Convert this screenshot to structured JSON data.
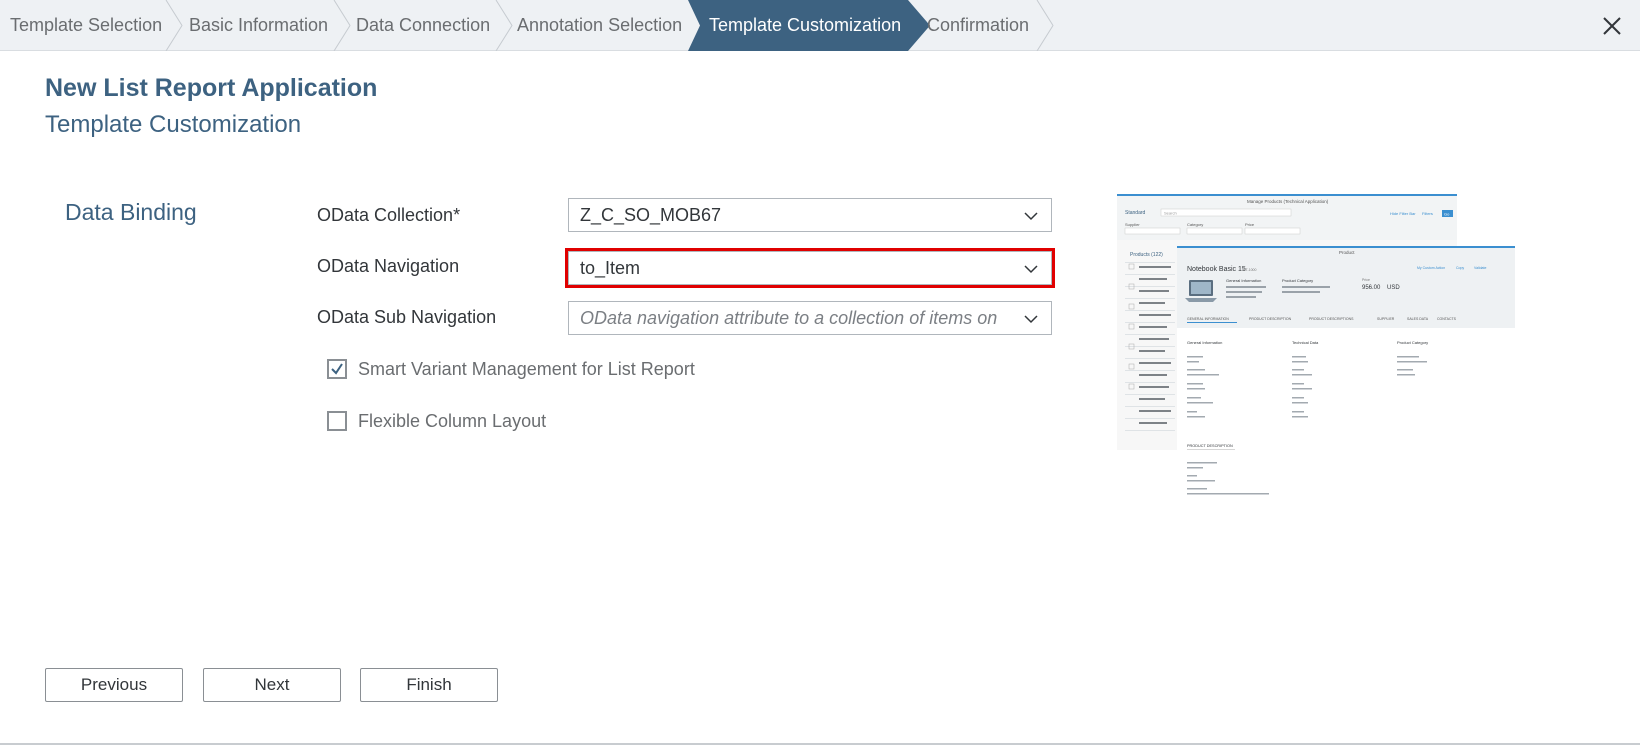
{
  "wizard": {
    "steps": [
      {
        "label": "Template Selection",
        "active": false
      },
      {
        "label": "Basic Information",
        "active": false
      },
      {
        "label": "Data Connection",
        "active": false
      },
      {
        "label": "Annotation Selection",
        "active": false
      },
      {
        "label": "Template Customization",
        "active": true
      },
      {
        "label": "Confirmation",
        "active": false
      }
    ],
    "active_color": "#3d6281"
  },
  "header": {
    "app_title": "New List Report Application",
    "page_subtitle": "Template Customization"
  },
  "data_binding": {
    "section_title": "Data Binding",
    "odata_collection": {
      "label": "OData Collection*",
      "value": "Z_C_SO_MOB67"
    },
    "odata_navigation": {
      "label": "OData Navigation",
      "value": "to_Item"
    },
    "odata_sub_navigation": {
      "label": "OData Sub Navigation",
      "placeholder": "OData navigation attribute to a collection of items on su"
    },
    "smart_variant": {
      "label": "Smart Variant Management for List Report",
      "checked": true
    },
    "flexible_column": {
      "label": "Flexible Column Layout",
      "checked": false
    }
  },
  "preview": {
    "list_header": "Manage Products (Technical Application)",
    "standard": "Standard",
    "search_placeholder": "Search",
    "filter_supplier": "Supplier",
    "filter_category": "Category",
    "filter_price": "Price",
    "hide_filter_bar": "Hide Filter Bar",
    "filters": "Filters",
    "go": "Go",
    "products_count": "Products (122)",
    "object_header": "Product",
    "product_title": "Notebook Basic 15",
    "product_id": "HT-1000",
    "actions": [
      "My Custom Action",
      "Copy",
      "Validate"
    ],
    "general_info": "General Information",
    "product_category": "Product Category",
    "price_label": "Price",
    "price_value": "956.00",
    "price_unit": "USD",
    "tabs": [
      "GENERAL INFORMATION",
      "PRODUCT DESCRIPTION",
      "PRODUCT DESCRIPTIONS",
      "SUPPLIER",
      "SALES DATA",
      "CONTACTS"
    ],
    "col1": "General Information",
    "col2": "Technical Data",
    "col3": "Product Category",
    "product_description": "PRODUCT DESCRIPTION"
  },
  "footer": {
    "previous": "Previous",
    "next": "Next",
    "finish": "Finish"
  }
}
